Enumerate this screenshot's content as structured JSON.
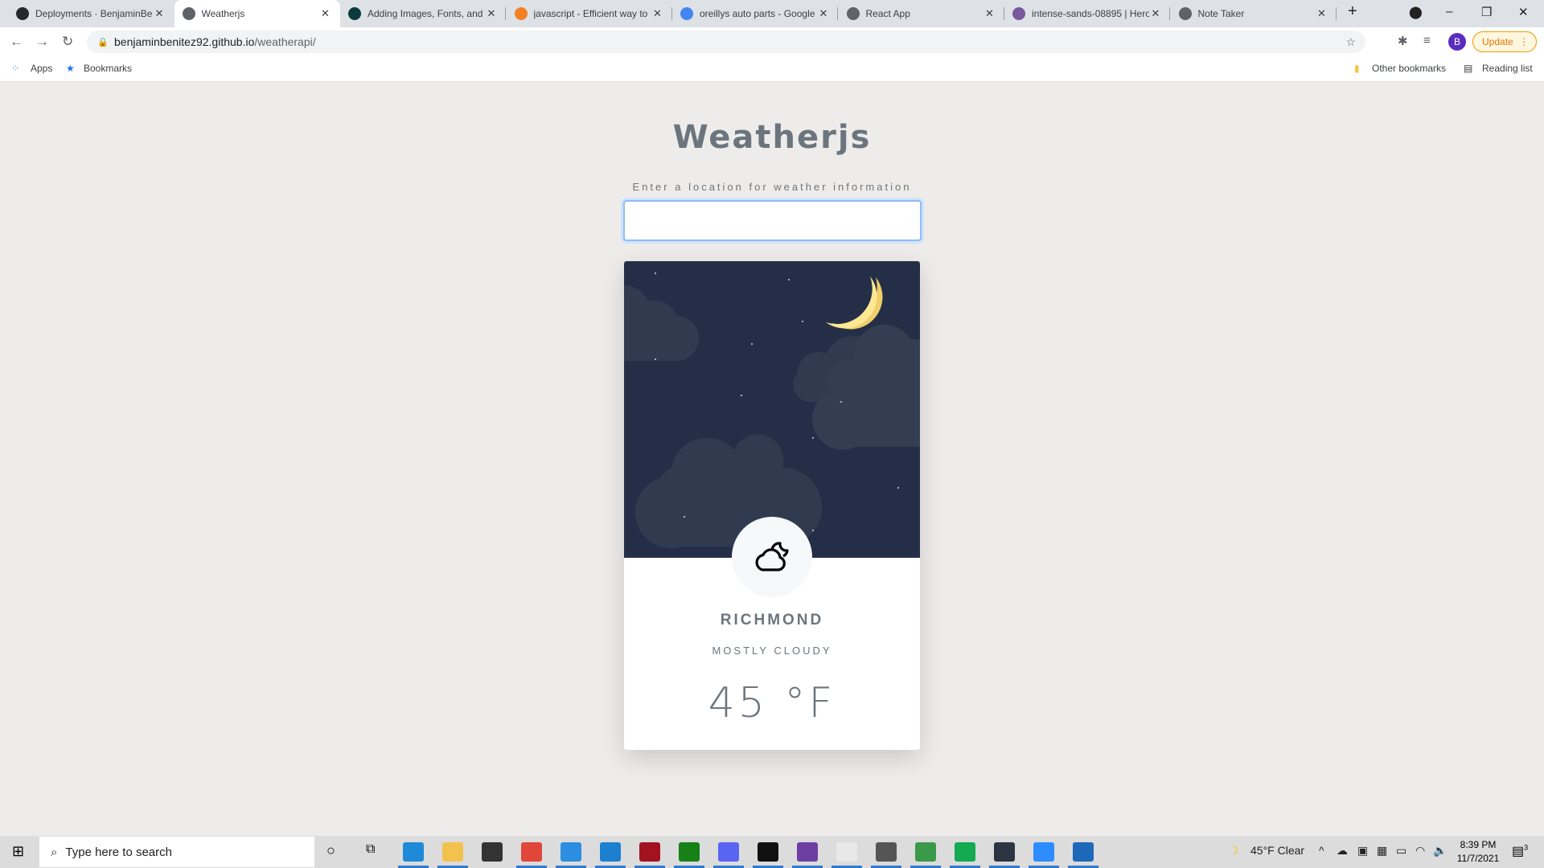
{
  "browser": {
    "tabs": [
      {
        "title": "Deployments · BenjaminBe",
        "icon": "github-icon",
        "color": "#24292e"
      },
      {
        "title": "Weatherjs",
        "icon": "globe-icon",
        "color": "#5f6368",
        "active": true
      },
      {
        "title": "Adding Images, Fonts, and",
        "icon": "react-icon",
        "color": "#0b3b3b"
      },
      {
        "title": "javascript - Efficient way to",
        "icon": "stackoverflow-icon",
        "color": "#f48024"
      },
      {
        "title": "oreillys auto parts - Google",
        "icon": "google-icon",
        "color": "#4285f4"
      },
      {
        "title": "React App",
        "icon": "globe-icon",
        "color": "#5f6368"
      },
      {
        "title": "intense-sands-08895 | Hero",
        "icon": "heroku-icon",
        "color": "#79589f"
      },
      {
        "title": "Note Taker",
        "icon": "globe-icon",
        "color": "#5f6368"
      }
    ],
    "url_host": "benjaminbenitez92.github.io",
    "url_path": "/weatherapi/",
    "profile_initial": "B",
    "update_label": "Update",
    "bookmarks": {
      "apps": "Apps",
      "bookmarks": "Bookmarks",
      "other": "Other bookmarks",
      "reading": "Reading list"
    }
  },
  "page": {
    "title": "Weatherjs",
    "subtitle": "Enter a location for weather information",
    "input_value": "",
    "card": {
      "city": "RICHMOND",
      "description": "MOSTLY CLOUDY",
      "temperature": "45 °F",
      "icon": "cloudy-night-icon"
    }
  },
  "taskbar": {
    "search_placeholder": "Type here to search",
    "weather": "45°F  Clear",
    "time": "8:39 PM",
    "date": "11/7/2021",
    "notifications": "3",
    "apps": [
      {
        "name": "edge",
        "color": "#1f8ad8",
        "running": true
      },
      {
        "name": "file-explorer",
        "color": "#f2c14e",
        "running": true
      },
      {
        "name": "store",
        "color": "#333",
        "running": false
      },
      {
        "name": "chrome",
        "color": "#e0463a",
        "running": true
      },
      {
        "name": "mail",
        "color": "#2b8ee0",
        "running": true
      },
      {
        "name": "vscode",
        "color": "#1a80cf",
        "running": true
      },
      {
        "name": "kali",
        "color": "#a3121f",
        "running": true
      },
      {
        "name": "xbox",
        "color": "#178017",
        "running": true
      },
      {
        "name": "discord",
        "color": "#5865f2",
        "running": true
      },
      {
        "name": "terminal",
        "color": "#111",
        "running": true
      },
      {
        "name": "github-desktop",
        "color": "#6e3fa3",
        "running": true
      },
      {
        "name": "slack",
        "color": "#e8e8e8",
        "running": true
      },
      {
        "name": "settings",
        "color": "#555",
        "running": true
      },
      {
        "name": "robo3t",
        "color": "#3a9a4a",
        "running": true
      },
      {
        "name": "mongodb-compass",
        "color": "#13aa52",
        "running": true
      },
      {
        "name": "norton",
        "color": "#2b3440",
        "running": true
      },
      {
        "name": "zoom",
        "color": "#2d8cff",
        "running": true
      },
      {
        "name": "photos",
        "color": "#1d68b8",
        "running": true
      }
    ]
  }
}
